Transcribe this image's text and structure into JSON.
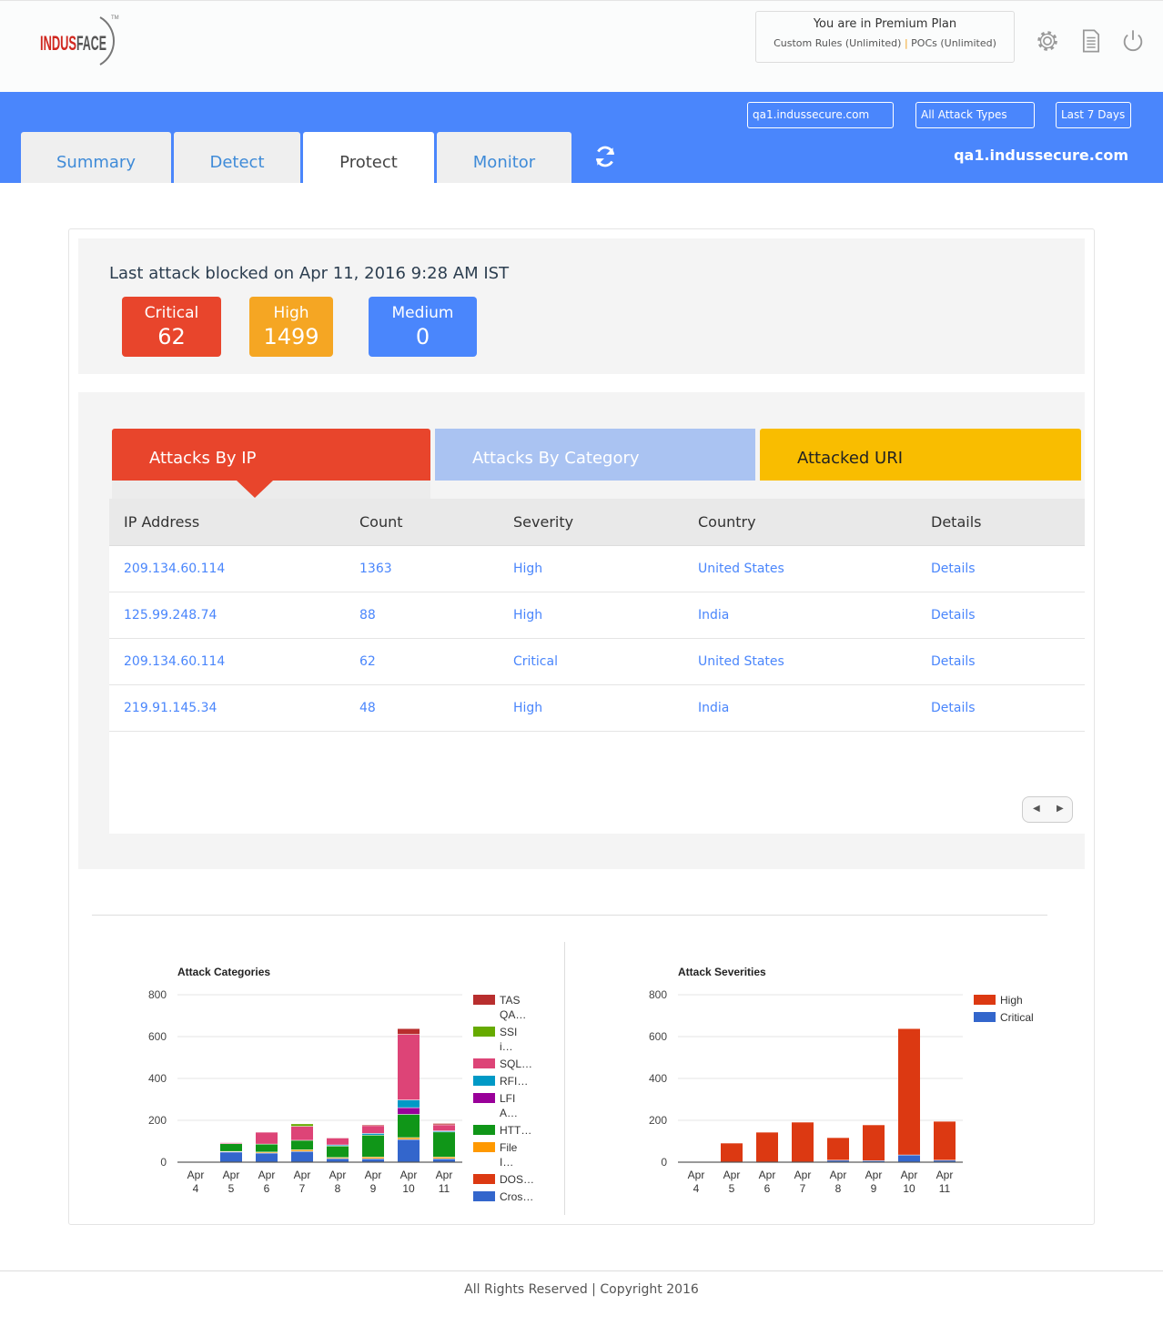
{
  "header": {
    "logo_text": "INDUSFACE",
    "plan_title": "You are in Premium Plan",
    "plan_rules": "Custom Rules (Unlimited)",
    "plan_separator": "|",
    "plan_pocs": "POCs (Unlimited)",
    "icons": [
      "gear-icon",
      "document-icon",
      "power-icon"
    ]
  },
  "nav": {
    "filters": {
      "site": "qa1.indussecure.com",
      "attack_types": "All Attack Types",
      "period": "Last 7 Days"
    },
    "tabs": [
      {
        "label": "Summary"
      },
      {
        "label": "Detect"
      },
      {
        "label": "Protect",
        "active": true
      },
      {
        "label": "Monitor"
      }
    ],
    "domain": "qa1.indussecure.com",
    "accent": "#4a86fc"
  },
  "last_attack": {
    "text": "Last attack blocked on Apr 11, 2016 9:28 AM IST",
    "cards": [
      {
        "label": "Critical",
        "value": "62",
        "color": "#e8452c"
      },
      {
        "label": "High",
        "value": "1499",
        "color": "#f5a623"
      },
      {
        "label": "Medium",
        "value": "0",
        "color": "#4a86fc"
      }
    ]
  },
  "panel_tabs": [
    {
      "label": "Attacks By IP",
      "color": "#e8452c",
      "active": true
    },
    {
      "label": "Attacks By Category",
      "color": "#aac3f2"
    },
    {
      "label": "Attacked URI",
      "color": "#f9bd00"
    }
  ],
  "table": {
    "headers": [
      "IP Address",
      "Count",
      "Severity",
      "Country",
      "Details"
    ],
    "rows": [
      [
        "209.134.60.114",
        "1363",
        "High",
        "United States",
        "Details"
      ],
      [
        "125.99.248.74",
        "88",
        "High",
        "India",
        "Details"
      ],
      [
        "209.134.60.114",
        "62",
        "Critical",
        "United States",
        "Details"
      ],
      [
        "219.91.145.34",
        "48",
        "High",
        "India",
        "Details"
      ]
    ]
  },
  "chart_data": [
    {
      "type": "bar",
      "stacked": true,
      "title": "Attack Categories",
      "categories": [
        "Apr 4",
        "Apr 5",
        "Apr 6",
        "Apr 7",
        "Apr 8",
        "Apr 9",
        "Apr 10",
        "Apr 11"
      ],
      "ylim": [
        0,
        800
      ],
      "yticks": [
        0,
        200,
        400,
        600,
        800
      ],
      "grid": true,
      "legend": "right",
      "series": [
        {
          "name": "Cros…",
          "color": "#3366cc",
          "values": [
            0,
            47,
            42,
            50,
            16,
            15,
            107,
            15
          ]
        },
        {
          "name": "DOS…",
          "color": "#dc3912",
          "values": [
            0,
            3,
            0,
            0,
            0,
            0,
            0,
            0
          ]
        },
        {
          "name": "File I…",
          "color": "#ff9900",
          "values": [
            0,
            0,
            5,
            8,
            5,
            8,
            9,
            8
          ]
        },
        {
          "name": "HTT…",
          "color": "#109618",
          "values": [
            0,
            37,
            38,
            45,
            55,
            105,
            111,
            120
          ]
        },
        {
          "name": "LFI A…",
          "color": "#990099",
          "values": [
            0,
            0,
            0,
            0,
            0,
            0,
            32,
            0
          ]
        },
        {
          "name": "RFI…",
          "color": "#0099c6",
          "values": [
            0,
            0,
            0,
            0,
            5,
            8,
            37,
            5
          ]
        },
        {
          "name": "SQL…",
          "color": "#dd4477",
          "values": [
            0,
            5,
            57,
            67,
            33,
            37,
            313,
            29
          ]
        },
        {
          "name": "SSI i…",
          "color": "#66aa00",
          "values": [
            0,
            0,
            0,
            12,
            0,
            0,
            0,
            0
          ]
        },
        {
          "name": "TAS QA…",
          "color": "#b82e2e",
          "values": [
            0,
            0,
            0,
            0,
            3,
            5,
            28,
            7
          ]
        }
      ]
    },
    {
      "type": "bar",
      "stacked": true,
      "title": "Attack Severities",
      "categories": [
        "Apr 4",
        "Apr 5",
        "Apr 6",
        "Apr 7",
        "Apr 8",
        "Apr 9",
        "Apr 10",
        "Apr 11"
      ],
      "ylim": [
        0,
        800
      ],
      "yticks": [
        0,
        200,
        400,
        600,
        800
      ],
      "grid": true,
      "legend": "right",
      "series": [
        {
          "name": "Critical",
          "color": "#3366cc",
          "values": [
            0,
            0,
            0,
            0,
            8,
            6,
            33,
            8
          ]
        },
        {
          "name": "High",
          "color": "#dc3912",
          "values": [
            0,
            90,
            142,
            190,
            108,
            171,
            604,
            186
          ]
        }
      ]
    }
  ],
  "footer": "All Rights Reserved | Copyright 2016"
}
